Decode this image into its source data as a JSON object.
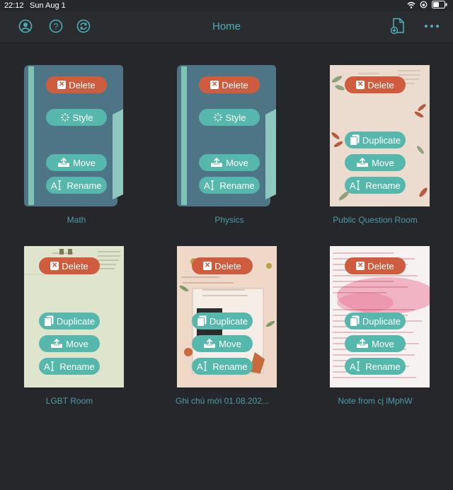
{
  "status": {
    "time": "22:12",
    "date": "Sun Aug 1"
  },
  "nav": {
    "title": "Home"
  },
  "icons": [
    "account-icon",
    "help-icon",
    "sync-icon",
    "new-document-icon",
    "more-icon"
  ],
  "colors": {
    "accent": "#4bb0b6",
    "delete": "#d05c3f",
    "action": "#56b7ad",
    "folder": "#4e7585"
  },
  "actions": {
    "delete": "Delete",
    "style": "Style",
    "move": "Move",
    "rename": "Rename",
    "duplicate": "Duplicate"
  },
  "items": [
    {
      "name": "Math",
      "kind": "folder"
    },
    {
      "name": "Physics",
      "kind": "folder"
    },
    {
      "name": "Public Question Room",
      "kind": "notebook"
    },
    {
      "name": "LGBT Room",
      "kind": "notebook"
    },
    {
      "name": "Ghi chú mới 01.08.202...",
      "kind": "notebook"
    },
    {
      "name": "Note from cj lMphW",
      "kind": "notebook"
    }
  ]
}
